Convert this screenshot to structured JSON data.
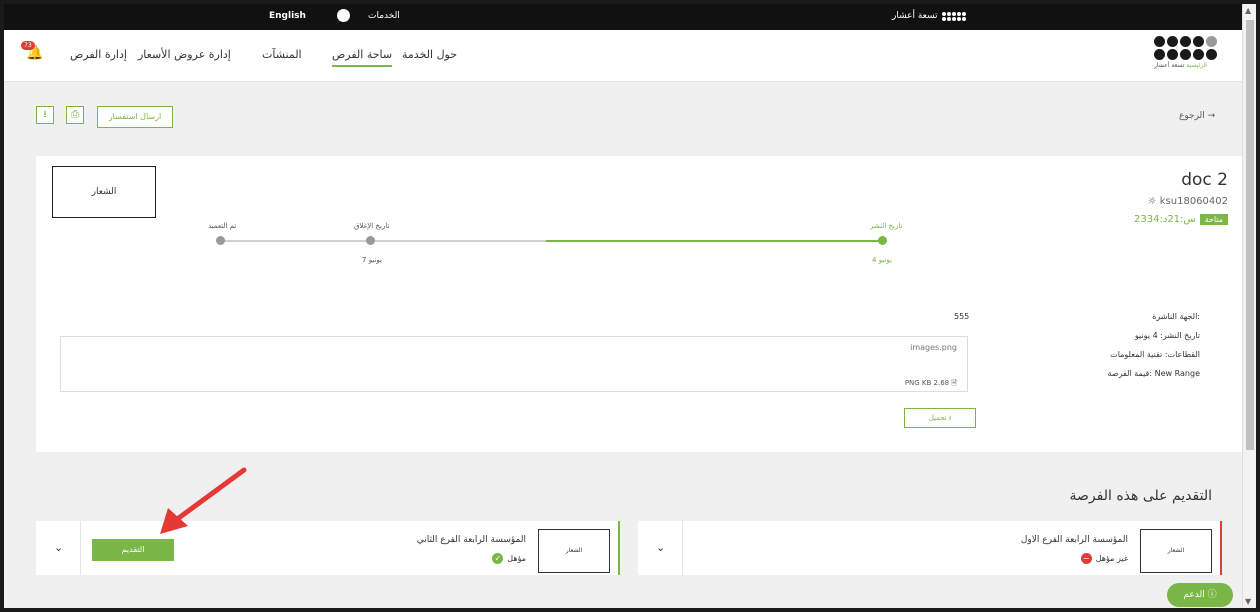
{
  "topbar": {
    "brand": "تسعة أعشار",
    "services": "الخدمات",
    "language": "English"
  },
  "nav": {
    "logo_text": "تسعة أعشار",
    "logo_sub": "الرئيسية",
    "links": [
      "حول الخدمة",
      "ساحة الفرص",
      "المنشآت",
      "إدارة عروض الأسعار",
      "إدارة الفرص"
    ],
    "notification_count": "73"
  },
  "actions": {
    "back": "الرجوع",
    "inquiry": "ارسال استفسار"
  },
  "opportunity": {
    "title": "doc 2",
    "code": "ksu18060402",
    "status": "متاحة",
    "countdown": "23س:21د:34",
    "logo": "الشعار",
    "timeline": [
      {
        "label": "تاريخ النشر",
        "date": "4 يونيو"
      },
      {
        "label": "تاريخ الإغلاق",
        "date": "7 يونيو"
      },
      {
        "label": "تم التعميد",
        "date": ""
      }
    ],
    "info": {
      "publisher_label": "الجهة الناشرة:",
      "publisher_value": "555",
      "publish_date_label": "تاريخ النشر:",
      "publish_date_value": "4 يونيو",
      "sectors_label": "القطاعات:",
      "sectors_value": "تقنية المعلومات",
      "value_label": "قيمة الفرصة:",
      "value_value": "New Range"
    },
    "attachment": {
      "name": "images.png",
      "size": "PNG KB 2.68",
      "download": "تحميل"
    }
  },
  "apply": {
    "title": "التقديم على هذه الفرصة",
    "institutions": [
      {
        "name": "المؤسسة الرابعة الفرع الاول",
        "status": "غير مؤهل",
        "logo": "الشعار"
      },
      {
        "name": "المؤسسة الرابعة الفرع الثاني",
        "status": "مؤهل",
        "logo": "الشعار"
      }
    ],
    "apply_button": "التقديم"
  },
  "support": "الدعم",
  "colors": {
    "accent": "#7ab648",
    "danger": "#e23b3b",
    "dark": "#111111"
  }
}
